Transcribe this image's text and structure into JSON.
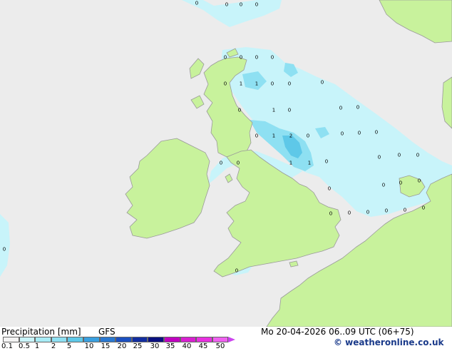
{
  "map": {
    "title": "Precipitation [mm]",
    "model": "GFS",
    "valid_time": "Mo 20-04-2026 06..09 UTC (06+75)",
    "credit": "© weatheronline.co.uk",
    "colors": {
      "sea": "#ececec",
      "land": "#c8f29c",
      "coast": "#9a9a9a",
      "precip_light": "#c8f4fa",
      "precip_medium": "#8ee0f2",
      "precip_heavy": "#5ec8e8"
    },
    "labels": [
      {
        "text": "0"
      },
      {
        "text": "0"
      },
      {
        "text": "0"
      },
      {
        "text": "0"
      },
      {
        "text": "0"
      },
      {
        "text": "0"
      },
      {
        "text": "0"
      },
      {
        "text": "0"
      },
      {
        "text": "0"
      },
      {
        "text": "1"
      },
      {
        "text": "1"
      },
      {
        "text": "0"
      },
      {
        "text": "0"
      },
      {
        "text": "0"
      },
      {
        "text": "0"
      },
      {
        "text": "1"
      },
      {
        "text": "0"
      },
      {
        "text": "0"
      },
      {
        "text": "0"
      },
      {
        "text": "0"
      },
      {
        "text": "1"
      },
      {
        "text": "2"
      },
      {
        "text": "0"
      },
      {
        "text": "0"
      },
      {
        "text": "0"
      },
      {
        "text": "0"
      },
      {
        "text": "0"
      },
      {
        "text": "0"
      },
      {
        "text": "1"
      },
      {
        "text": "1"
      },
      {
        "text": "0"
      },
      {
        "text": "0"
      },
      {
        "text": "0"
      },
      {
        "text": "0"
      },
      {
        "text": "0"
      },
      {
        "text": "0"
      },
      {
        "text": "0"
      },
      {
        "text": "0"
      },
      {
        "text": "0"
      },
      {
        "text": "0"
      },
      {
        "text": "0"
      },
      {
        "text": "0"
      },
      {
        "text": "0"
      },
      {
        "text": "0"
      },
      {
        "text": "0"
      },
      {
        "text": "0"
      }
    ]
  },
  "legend": {
    "ticks": [
      "0.1",
      "0.5",
      "1",
      "2",
      "5",
      "10",
      "15",
      "20",
      "25",
      "30",
      "35",
      "40",
      "45",
      "50"
    ],
    "colors": [
      "#f4f4f4",
      "#c8f4fa",
      "#a8ecf6",
      "#8ee0f2",
      "#5ec8e8",
      "#3aa0e0",
      "#2a78d0",
      "#1c50c0",
      "#122ea0",
      "#0a1080",
      "#c000c0",
      "#d820d0",
      "#e830e0",
      "#f060f0"
    ]
  }
}
